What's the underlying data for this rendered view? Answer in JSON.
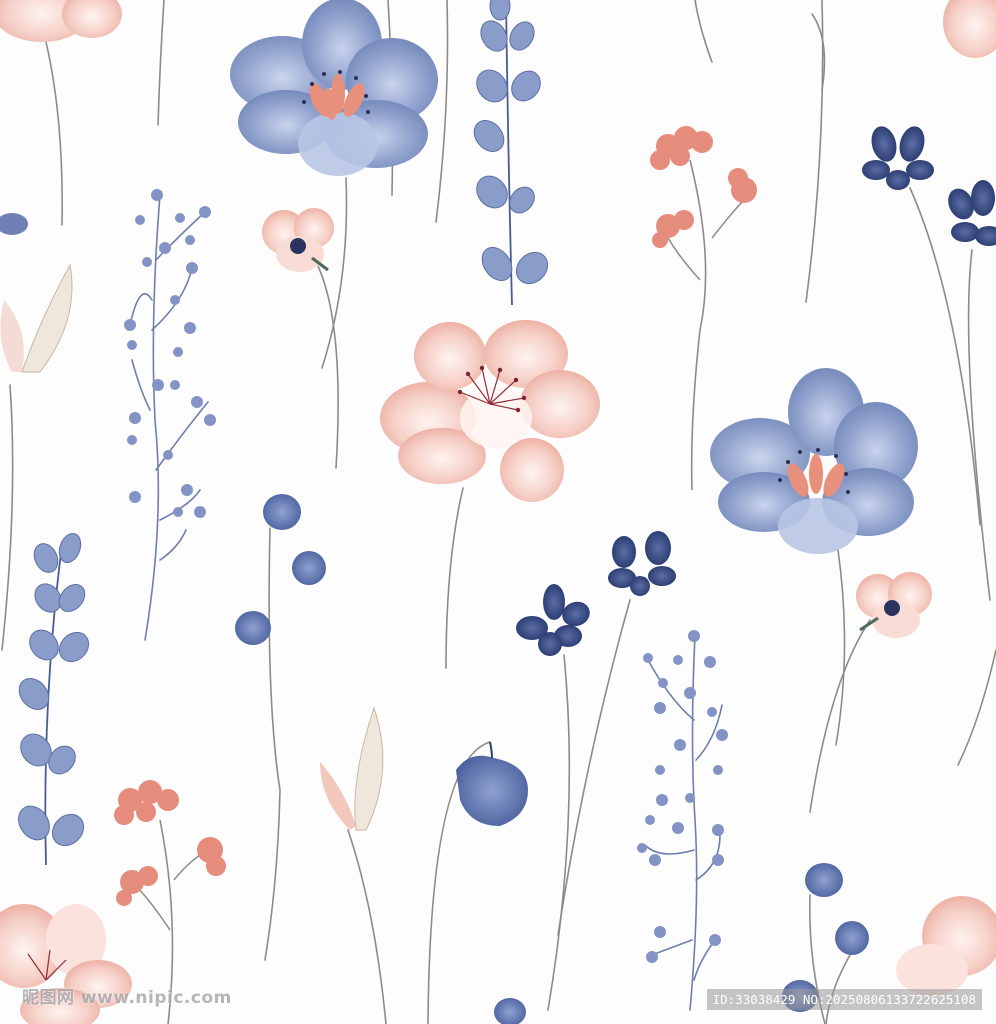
{
  "watermark": {
    "site": "昵图网 www.nipic.com",
    "id_text": "ID:33038429 NO:20250806133722625108"
  },
  "palette": {
    "background": "#fdfdfd",
    "dusty_blue": "#8a9cc8",
    "navy": "#2e3f72",
    "blush": "#f2c4bb",
    "coral": "#e48a7a",
    "stem": "#8e8a86"
  }
}
